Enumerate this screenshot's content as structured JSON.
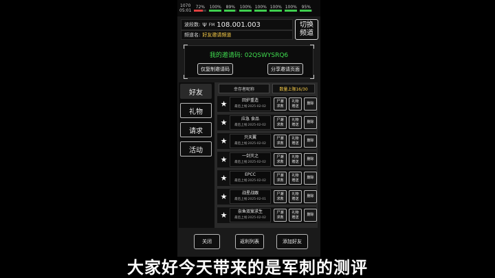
{
  "status": {
    "time": "05:01",
    "fps": "1070",
    "b1": "72%",
    "b2": "100%",
    "b3": "89%",
    "b4": "100%",
    "b5": "100%",
    "b6": "100%",
    "b7": "100%",
    "b8": "95%"
  },
  "radio": {
    "freq_label": "波段数:",
    "freq_prefix": "FM",
    "freq_value": "108.001.003",
    "channel_label": "频道名:",
    "channel_value": "好友邀请频道",
    "switch_label": "切换\n频道"
  },
  "invite": {
    "code_text": "我的邀请码: 02QSWYSRQ6",
    "copy_button": "仅复制邀请码",
    "share_button": "分享邀请页面"
  },
  "tabs": [
    "好友",
    "礼物",
    "请求",
    "活动"
  ],
  "list_header": {
    "name_col": "幸存者昵称",
    "count": "数量上限16/30"
  },
  "row_buttons": {
    "help": "尸潮\n求救",
    "gift": "礼物\n赠送",
    "delete": "删除"
  },
  "friends": [
    {
      "name": "回炉重造",
      "last": "最后上线:2025-02-02"
    },
    {
      "name": "应急  食品",
      "last": "最后上线:2025-02-02"
    },
    {
      "name": "只天翼",
      "last": "最后上线:2025-02-02"
    },
    {
      "name": "一剑灭之",
      "last": "最后上线:2025-02-02"
    },
    {
      "name": "EPCC",
      "last": "最后上线:2025-02-02"
    },
    {
      "name": "战星战跟",
      "last": "最后上线:2025-02-01"
    },
    {
      "name": "奈鱼双案求生",
      "last": "最后上线:2025-02-02"
    }
  ],
  "bottom": {
    "close": "关闭",
    "return_list": "返利列表",
    "add_friend": "添加好友"
  },
  "subtitle": "大家好今天带来的是军刺的测评"
}
